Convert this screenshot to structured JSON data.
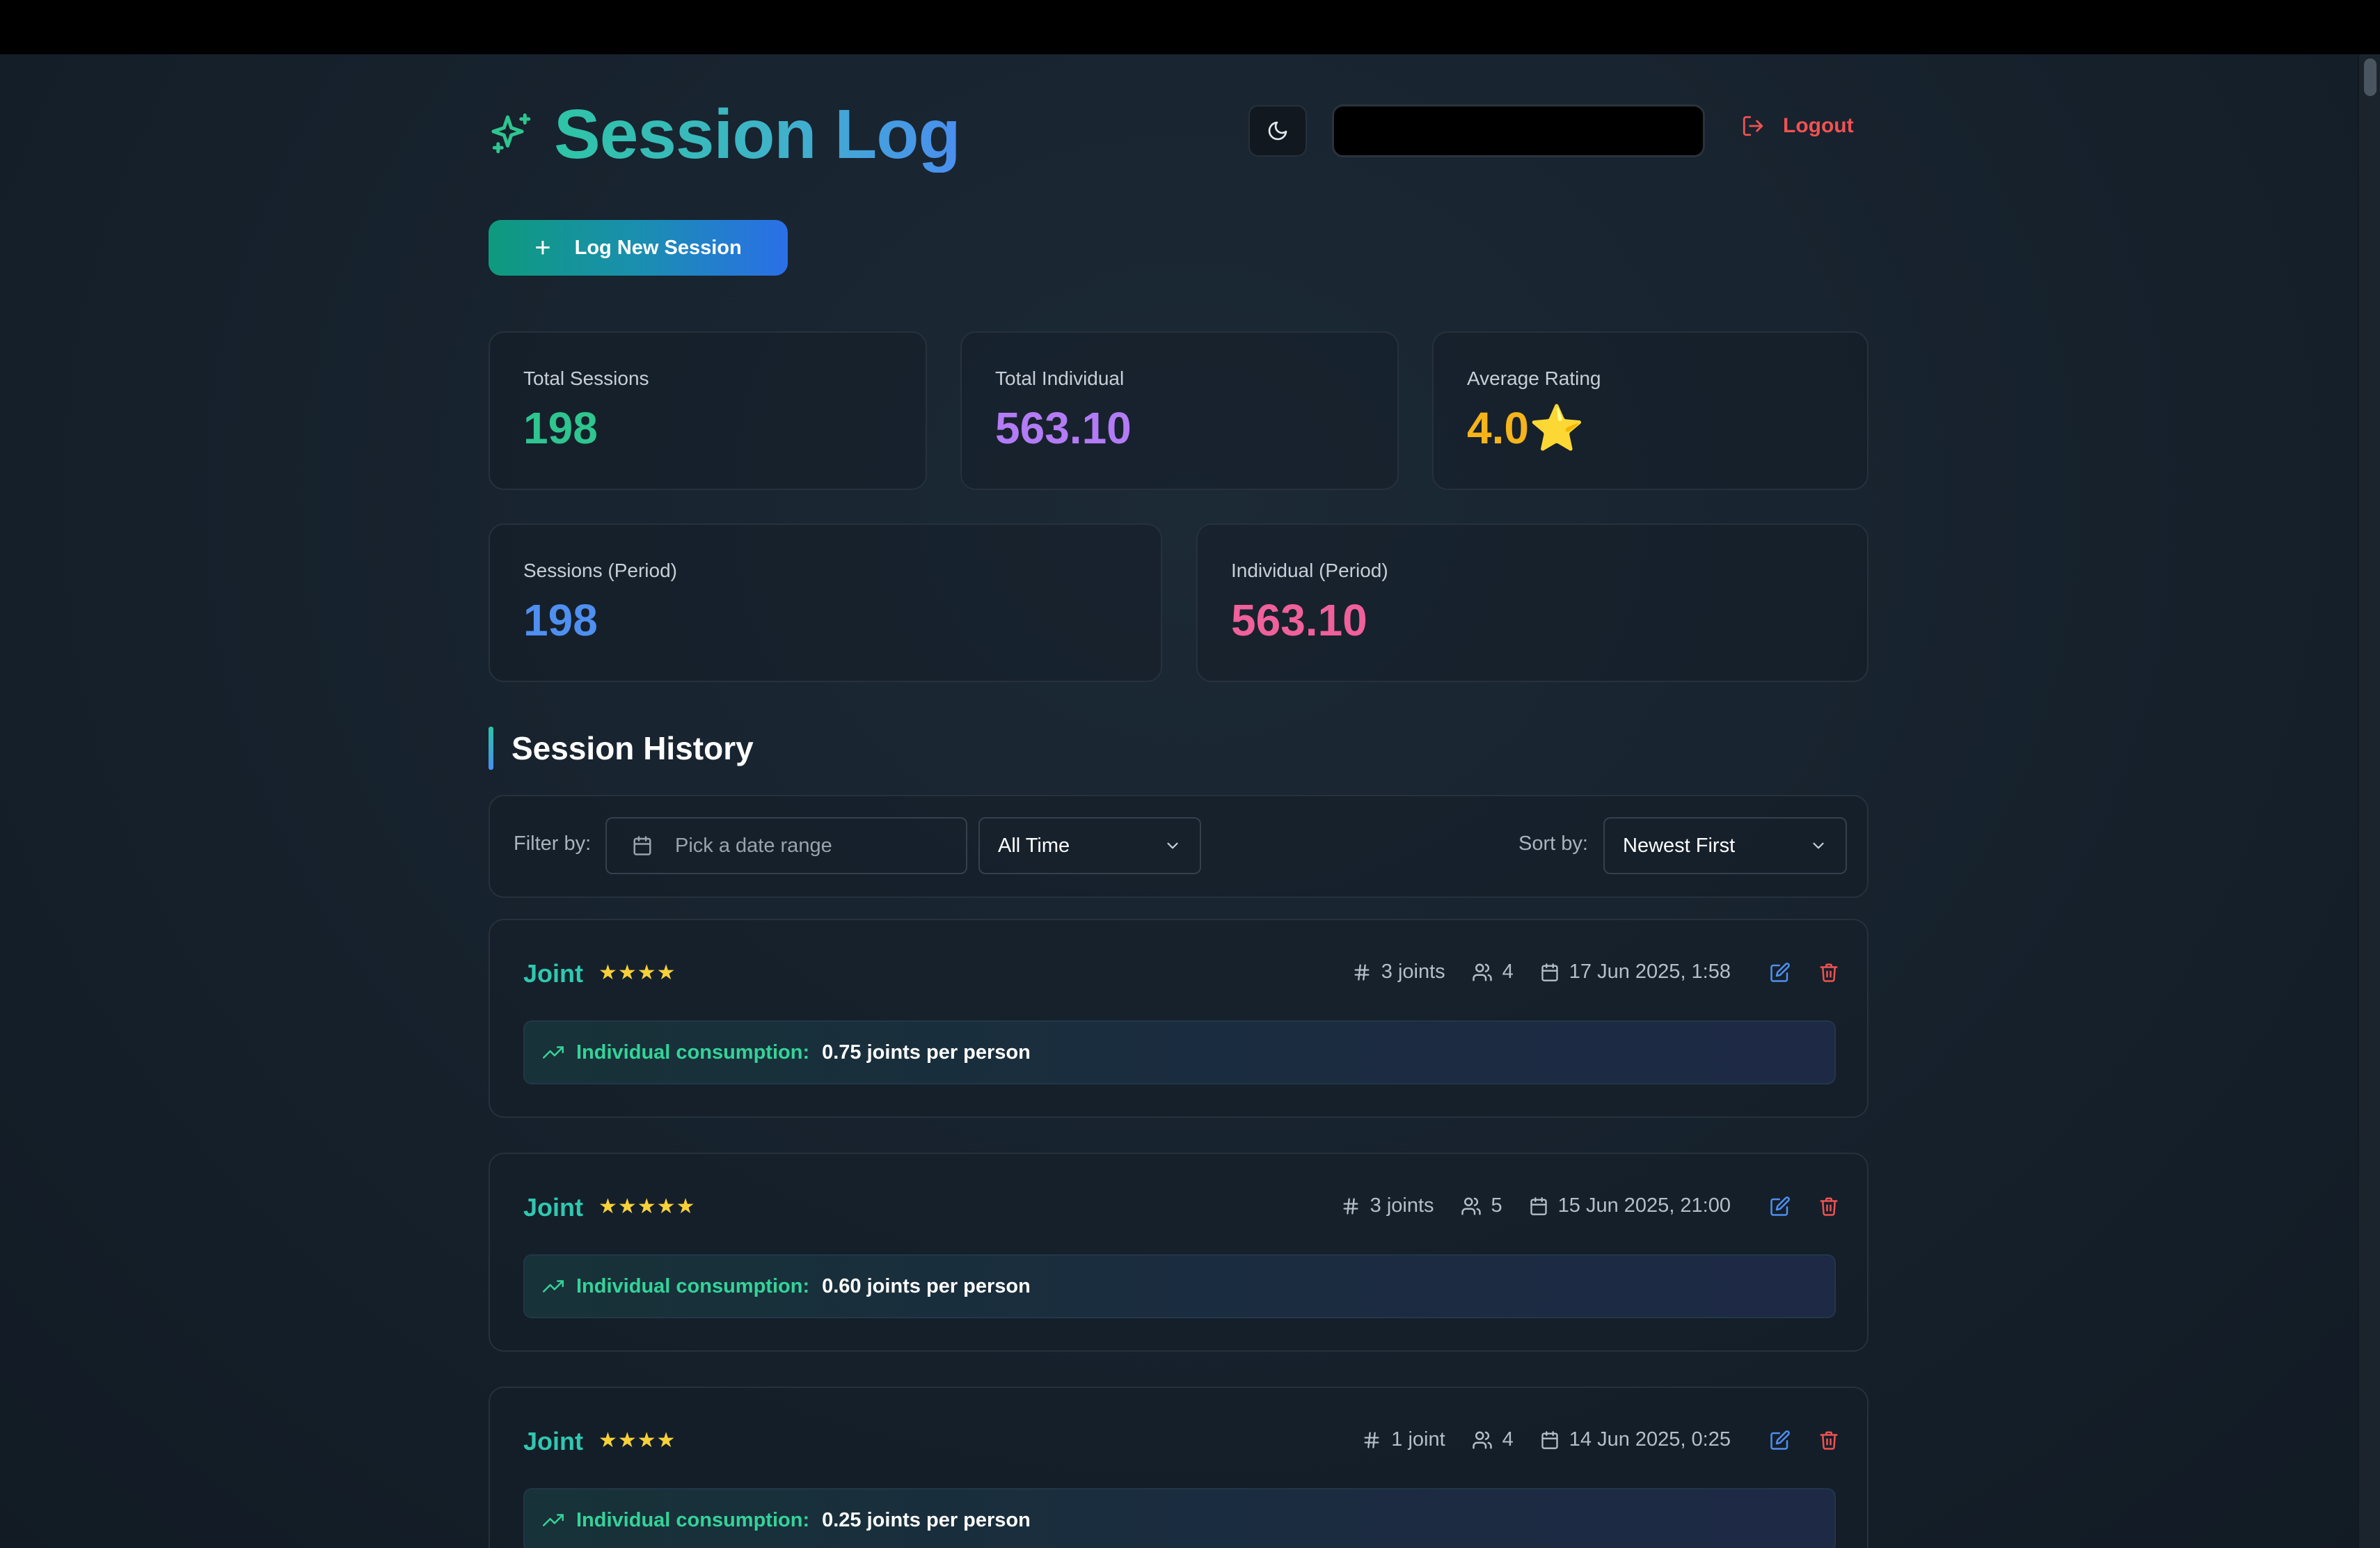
{
  "header": {
    "title": "Session Log",
    "logout_label": "Logout"
  },
  "actions": {
    "new_session_label": "Log New Session"
  },
  "stats": [
    {
      "label": "Total Sessions",
      "value": "198",
      "color": "#2fc58f"
    },
    {
      "label": "Total Individual",
      "value": "563.10",
      "color": "#b37bf5"
    },
    {
      "label": "Average Rating",
      "value": "4.0⭐",
      "color": "#f5b41a"
    },
    {
      "label": "Sessions (Period)",
      "value": "198",
      "color": "#4f8ff0"
    },
    {
      "label": "Individual (Period)",
      "value": "563.10",
      "color": "#f0609a"
    }
  ],
  "history": {
    "title": "Session History",
    "filter_label": "Filter by:",
    "date_placeholder": "Pick a date range",
    "period_value": "All Time",
    "sort_label": "Sort by:",
    "sort_value": "Newest First"
  },
  "sessions": [
    {
      "type": "Joint",
      "rating": 4,
      "stars": "★★★★",
      "count": "3 joints",
      "people": "4",
      "datetime": "17 Jun 2025, 1:58",
      "consumption_label": "Individual consumption:",
      "consumption_value": "0.75 joints per person"
    },
    {
      "type": "Joint",
      "rating": 5,
      "stars": "★★★★★",
      "count": "3 joints",
      "people": "5",
      "datetime": "15 Jun 2025, 21:00",
      "consumption_label": "Individual consumption:",
      "consumption_value": "0.60 joints per person"
    },
    {
      "type": "Joint",
      "rating": 4,
      "stars": "★★★★",
      "count": "1 joint",
      "people": "4",
      "datetime": "14 Jun 2025, 0:25",
      "consumption_label": "Individual consumption:",
      "consumption_value": "0.25 joints per person"
    }
  ],
  "colors": {
    "accent_teal": "#2fc8b0",
    "accent_blue": "#4a8ef0",
    "danger": "#f05252",
    "star": "#f8d13a"
  }
}
